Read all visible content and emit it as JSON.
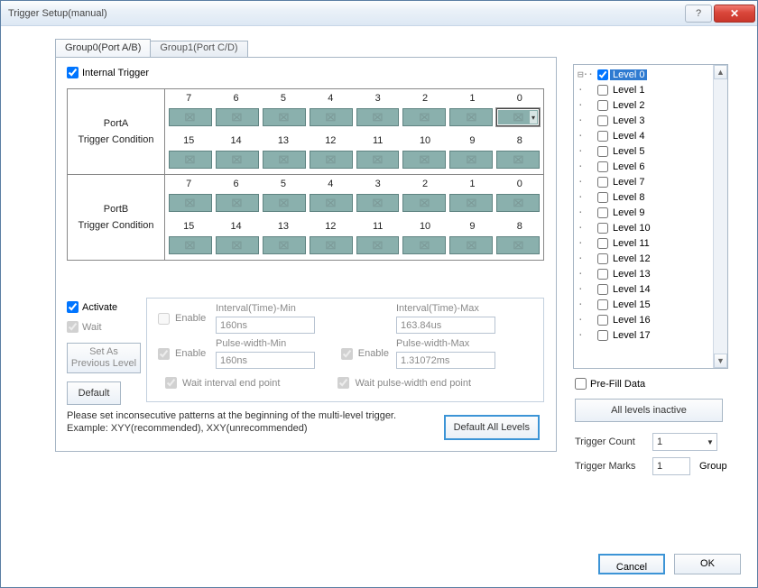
{
  "window": {
    "title": "Trigger Setup(manual)"
  },
  "tabs": {
    "group0": "Group0(Port A/B)",
    "group1": "Group1(Port C/D)"
  },
  "internal_trigger": {
    "label": "Internal Trigger",
    "checked": true
  },
  "ports": {
    "a": {
      "name": "PortA",
      "cond_label": "Trigger Condition"
    },
    "b": {
      "name": "PortB",
      "cond_label": "Trigger Condition"
    },
    "bits_high": [
      "7",
      "6",
      "5",
      "4",
      "3",
      "2",
      "1",
      "0"
    ],
    "bits_low": [
      "15",
      "14",
      "13",
      "12",
      "11",
      "10",
      "9",
      "8"
    ]
  },
  "options": {
    "activate": {
      "label": "Activate",
      "checked": true
    },
    "wait": {
      "label": "Wait",
      "checked": true
    },
    "set_prev": "Set As Previous Level",
    "default_btn": "Default",
    "enable": "Enable",
    "interval_min": {
      "label": "Interval(Time)-Min",
      "value": "160ns"
    },
    "interval_max": {
      "label": "Interval(Time)-Max",
      "value": "163.84us"
    },
    "pulse_min": {
      "label": "Pulse-width-Min",
      "value": "160ns"
    },
    "pulse_max": {
      "label": "Pulse-width-Max",
      "value": "1.31072ms"
    },
    "wait_interval_end": "Wait interval end point",
    "wait_pulse_end": "Wait pulse-width end point"
  },
  "default_all": "Default All Levels",
  "hint_line1": "Please set inconsecutive patterns at the beginning of the multi-level trigger.",
  "hint_line2": "Example: XYY(recommended), XXY(unrecommended)",
  "levels": [
    "Level 0",
    "Level 1",
    "Level 2",
    "Level 3",
    "Level 4",
    "Level 5",
    "Level 6",
    "Level 7",
    "Level 8",
    "Level 9",
    "Level 10",
    "Level 11",
    "Level 12",
    "Level 13",
    "Level 14",
    "Level 15",
    "Level 16",
    "Level 17"
  ],
  "level_checked_index": 0,
  "prefill": {
    "label": "Pre-Fill Data",
    "checked": false
  },
  "all_inactive": "All levels inactive",
  "trigger_count": {
    "label": "Trigger Count",
    "value": "1"
  },
  "trigger_marks": {
    "label": "Trigger Marks",
    "value": "1",
    "suffix": "Group"
  },
  "buttons": {
    "ok": "OK",
    "cancel": "Cancel"
  }
}
